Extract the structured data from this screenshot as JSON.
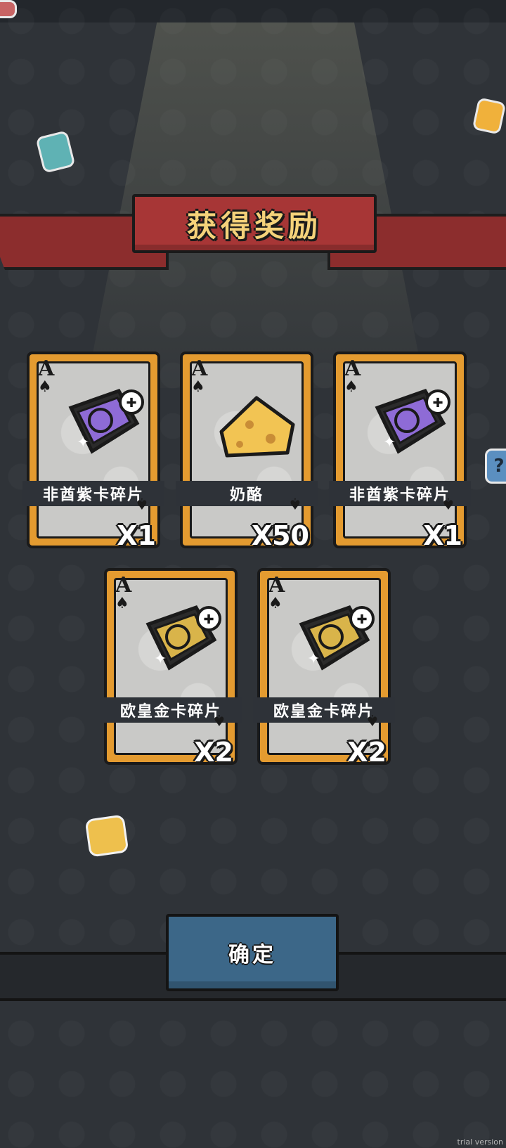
{
  "banner": {
    "title": "获得奖励"
  },
  "rewards": [
    {
      "rank": "A",
      "suit": "♠",
      "name": "非酋紫卡碎片",
      "quantity": "X1",
      "item_icon": "purple-card-fragment-icon",
      "color": "#8e6bd6"
    },
    {
      "rank": "A",
      "suit": "♠",
      "name": "奶酪",
      "quantity": "X50",
      "item_icon": "cheese-icon",
      "color": "#f2c453"
    },
    {
      "rank": "A",
      "suit": "♠",
      "name": "非酋紫卡碎片",
      "quantity": "X1",
      "item_icon": "purple-card-fragment-icon",
      "color": "#8e6bd6"
    },
    {
      "rank": "A",
      "suit": "♠",
      "name": "欧皇金卡碎片",
      "quantity": "X2",
      "item_icon": "gold-card-fragment-icon",
      "color": "#d9b44a"
    },
    {
      "rank": "A",
      "suit": "♠",
      "name": "欧皇金卡碎片",
      "quantity": "X2",
      "item_icon": "gold-card-fragment-icon",
      "color": "#d9b44a"
    }
  ],
  "confirm_button": {
    "label": "确定"
  },
  "watermark": "trial version",
  "colors": {
    "card_frame": "#e49b30",
    "banner": "#a73636",
    "button": "#3c6788",
    "background": "#2f3338"
  }
}
